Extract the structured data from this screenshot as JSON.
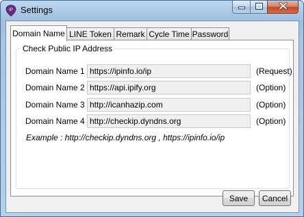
{
  "window": {
    "title": "Settings",
    "icon": "ip-pin-icon",
    "icon_text": "IP"
  },
  "tabs": [
    {
      "label": "Domain Name",
      "active": true
    },
    {
      "label": "LINE Token",
      "active": false
    },
    {
      "label": "Remark",
      "active": false
    },
    {
      "label": "Cycle Time",
      "active": false
    },
    {
      "label": "Password",
      "active": false
    }
  ],
  "group": {
    "title": "Check Public IP Address",
    "rows": [
      {
        "label": "Domain Name 1 :",
        "value": "https://ipinfo.io/ip",
        "note": "(Request)"
      },
      {
        "label": "Domain Name 2 :",
        "value": "https://api.ipify.org",
        "note": "(Option)"
      },
      {
        "label": "Domain Name 3 :",
        "value": "http://icanhazip.com",
        "note": "(Option)"
      },
      {
        "label": "Domain Name 4 :",
        "value": "http://checkip.dyndns.org",
        "note": "(Option)"
      }
    ],
    "example": "Example : http://checkip.dyndns.org , https://ipinfo.io/ip"
  },
  "buttons": {
    "save": "Save",
    "cancel": "Cancel"
  },
  "colors": {
    "title_frame": "#a9c7e6",
    "icon_purple": "#6a2c7c",
    "close_red": "#c04a2a"
  }
}
